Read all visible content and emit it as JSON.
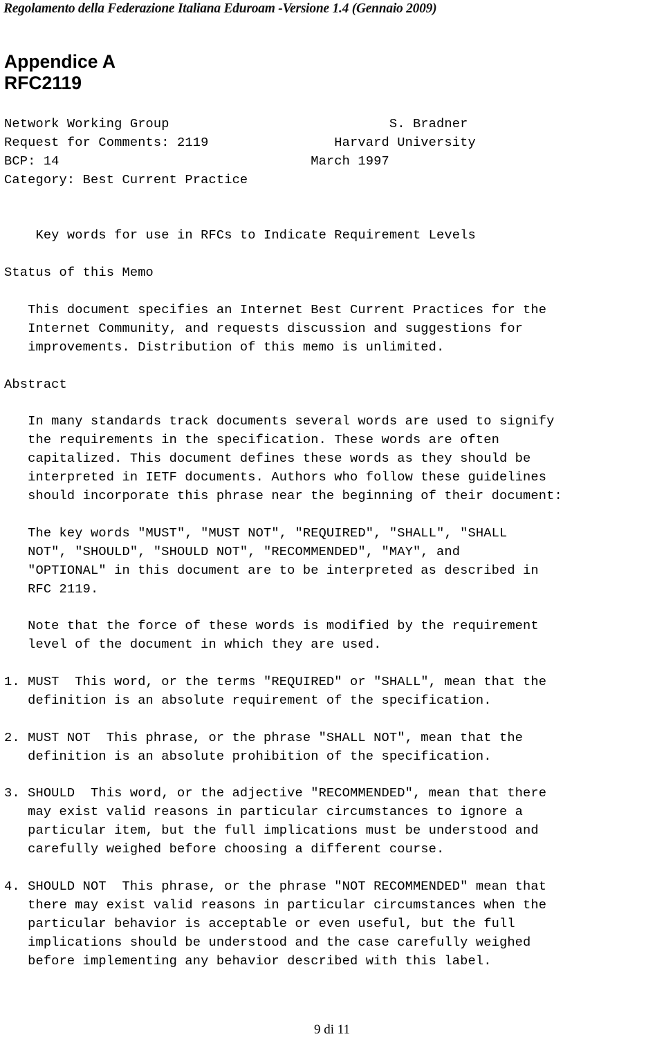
{
  "document": {
    "running_header": "Regolamento della Federazione Italiana Eduroam -Versione 1.4 (Gennaio 2009)",
    "footer": "9 di 11",
    "title_line_1": "Appendice A",
    "title_line_2": "RFC2119"
  },
  "rfc": {
    "masthead": {
      "left": [
        "Network Working Group",
        "Request for Comments: 2119",
        "BCP: 14",
        "Category: Best Current Practice"
      ],
      "right": [
        "S. Bradner",
        "Harvard University",
        "March 1997"
      ]
    },
    "doc_title": "Key words for use in RFCs to Indicate Requirement Levels",
    "sections": [
      {
        "heading": "Status of this Memo",
        "paragraphs": [
          [
            "This document specifies an Internet Best Current Practices for the",
            "Internet Community, and requests discussion and suggestions for",
            "improvements. Distribution of this memo is unlimited."
          ]
        ]
      },
      {
        "heading": "Abstract",
        "paragraphs": [
          [
            "In many standards track documents several words are used to signify",
            "the requirements in the specification. These words are often",
            "capitalized. This document defines these words as they should be",
            "interpreted in IETF documents. Authors who follow these guidelines",
            "should incorporate this phrase near the beginning of their document:"
          ],
          [
            "The key words \"MUST\", \"MUST NOT\", \"REQUIRED\", \"SHALL\", \"SHALL",
            "NOT\", \"SHOULD\", \"SHOULD NOT\", \"RECOMMENDED\", \"MAY\", and",
            "\"OPTIONAL\" in this document are to be interpreted as described in",
            "RFC 2119."
          ],
          [
            "Note that the force of these words is modified by the requirement",
            "level of the document in which they are used."
          ]
        ]
      }
    ],
    "definitions": [
      {
        "number": "1.",
        "term": "MUST",
        "lines": [
          "1. MUST  This word, or the terms \"REQUIRED\" or \"SHALL\", mean that the",
          "   definition is an absolute requirement of the specification."
        ]
      },
      {
        "number": "2.",
        "term": "MUST NOT",
        "lines": [
          "2. MUST NOT  This phrase, or the phrase \"SHALL NOT\", mean that the",
          "   definition is an absolute prohibition of the specification."
        ]
      },
      {
        "number": "3.",
        "term": "SHOULD",
        "lines": [
          "3. SHOULD  This word, or the adjective \"RECOMMENDED\", mean that there",
          "   may exist valid reasons in particular circumstances to ignore a",
          "   particular item, but the full implications must be understood and",
          "   carefully weighed before choosing a different course."
        ]
      },
      {
        "number": "4.",
        "term": "SHOULD NOT",
        "lines": [
          "4. SHOULD NOT  This phrase, or the phrase \"NOT RECOMMENDED\" mean that",
          "   there may exist valid reasons in particular circumstances when the",
          "   particular behavior is acceptable or even useful, but the full",
          "   implications should be understood and the case carefully weighed",
          "   before implementing any behavior described with this label."
        ]
      }
    ],
    "masthead_rows": [
      "Network Working Group                            S. Bradner",
      "Request for Comments: 2119                Harvard University",
      "BCP: 14                                March 1997",
      "Category: Best Current Practice"
    ],
    "title_row": "    Key words for use in RFCs to Indicate Requirement Levels",
    "body_rows": [
      "Status of this Memo",
      "",
      "   This document specifies an Internet Best Current Practices for the",
      "   Internet Community, and requests discussion and suggestions for",
      "   improvements. Distribution of this memo is unlimited.",
      "",
      "Abstract",
      "",
      "   In many standards track documents several words are used to signify",
      "   the requirements in the specification. These words are often",
      "   capitalized. This document defines these words as they should be",
      "   interpreted in IETF documents. Authors who follow these guidelines",
      "   should incorporate this phrase near the beginning of their document:",
      "",
      "   The key words \"MUST\", \"MUST NOT\", \"REQUIRED\", \"SHALL\", \"SHALL",
      "   NOT\", \"SHOULD\", \"SHOULD NOT\", \"RECOMMENDED\", \"MAY\", and",
      "   \"OPTIONAL\" in this document are to be interpreted as described in",
      "   RFC 2119.",
      "",
      "   Note that the force of these words is modified by the requirement",
      "   level of the document in which they are used.",
      "",
      "1. MUST  This word, or the terms \"REQUIRED\" or \"SHALL\", mean that the",
      "   definition is an absolute requirement of the specification.",
      "",
      "2. MUST NOT  This phrase, or the phrase \"SHALL NOT\", mean that the",
      "   definition is an absolute prohibition of the specification.",
      "",
      "3. SHOULD  This word, or the adjective \"RECOMMENDED\", mean that there",
      "   may exist valid reasons in particular circumstances to ignore a",
      "   particular item, but the full implications must be understood and",
      "   carefully weighed before choosing a different course.",
      "",
      "4. SHOULD NOT  This phrase, or the phrase \"NOT RECOMMENDED\" mean that",
      "   there may exist valid reasons in particular circumstances when the",
      "   particular behavior is acceptable or even useful, but the full",
      "   implications should be understood and the case carefully weighed",
      "   before implementing any behavior described with this label."
    ]
  },
  "colors": {
    "page_background": "#ffffff",
    "text": "#000000",
    "header_text": "#111111"
  }
}
